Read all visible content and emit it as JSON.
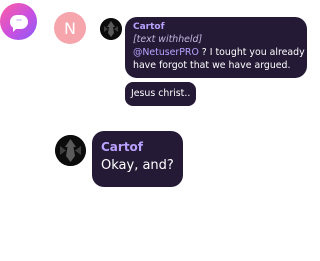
{
  "icons": {
    "app": "chat-bubble-icon",
    "app_glyph": "···"
  },
  "contacts": {
    "letter_avatar": "N"
  },
  "conversation": {
    "reply_preview": {
      "author": "Cartof",
      "line1_withheld": "[text withheld]",
      "line2_mention": "@NetuserPRO",
      "line2_rest": " ? I tought you already",
      "line3": "have forgot that we have argued."
    },
    "reply": "Jesus christ..",
    "message": {
      "author": "Cartof",
      "text": "Okay, and?"
    }
  },
  "colors": {
    "bubble": "#241a36",
    "author": "#b9a2ff",
    "letter_avatar_bg": "#f6a5ad"
  }
}
